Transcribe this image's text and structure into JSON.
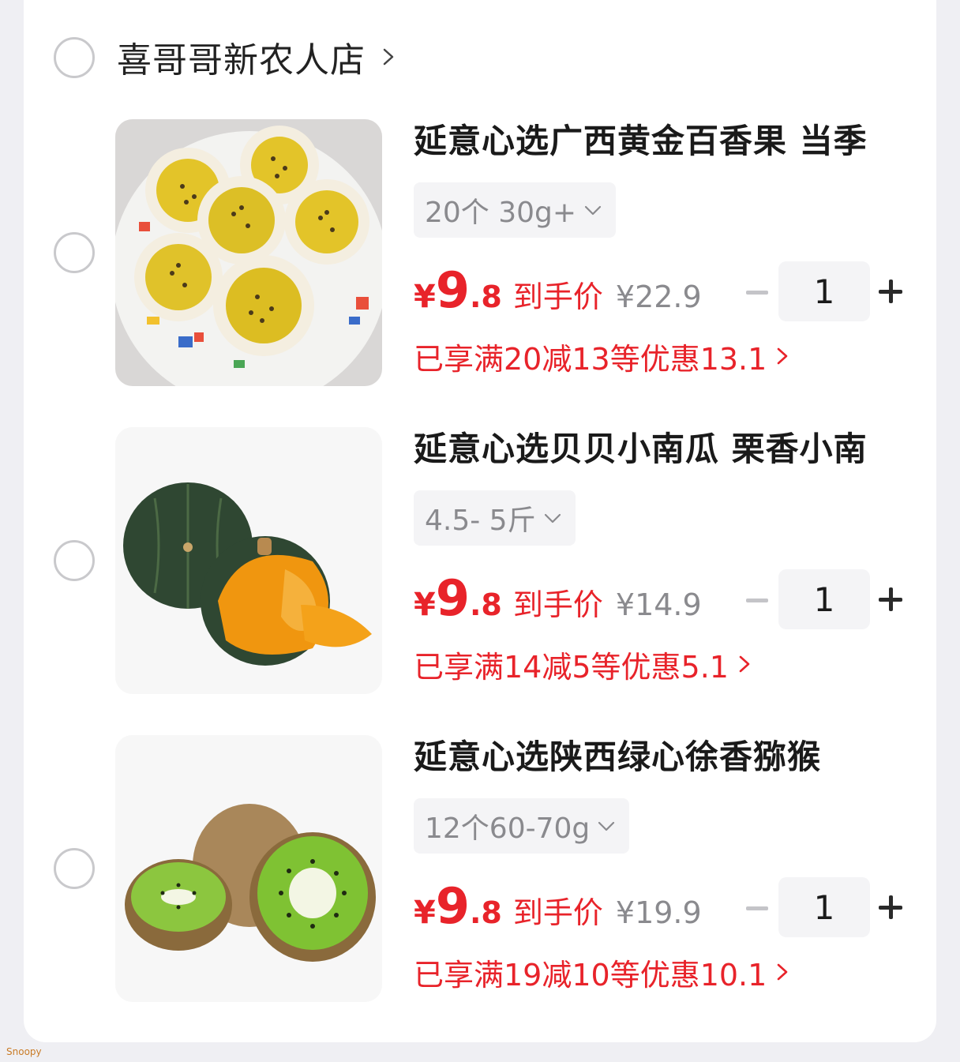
{
  "shop": {
    "name": "喜哥哥新农人店"
  },
  "items": [
    {
      "title": "延意心选广西黄金百香果 当季",
      "spec": "20个 30g+",
      "price_currency": "¥",
      "price_int": "9",
      "price_dec": ".8",
      "price_label": "到手价",
      "original_price": "¥22.9",
      "quantity": "1",
      "promo": "已享满20减13等优惠13.1"
    },
    {
      "title": "延意心选贝贝小南瓜 栗香小南",
      "spec": "4.5- 5斤",
      "price_currency": "¥",
      "price_int": "9",
      "price_dec": ".8",
      "price_label": "到手价",
      "original_price": "¥14.9",
      "quantity": "1",
      "promo": "已享满14减5等优惠5.1"
    },
    {
      "title": "延意心选陕西绿心徐香猕猴",
      "spec": "12个60-70g",
      "price_currency": "¥",
      "price_int": "9",
      "price_dec": ".8",
      "price_label": "到手价",
      "original_price": "¥19.9",
      "quantity": "1",
      "promo": "已享满19减10等优惠10.1"
    }
  ],
  "watermark": "Snoopy",
  "colors": {
    "accent": "#e8232a",
    "muted": "#8a8a8e",
    "background": "#efeff3"
  }
}
